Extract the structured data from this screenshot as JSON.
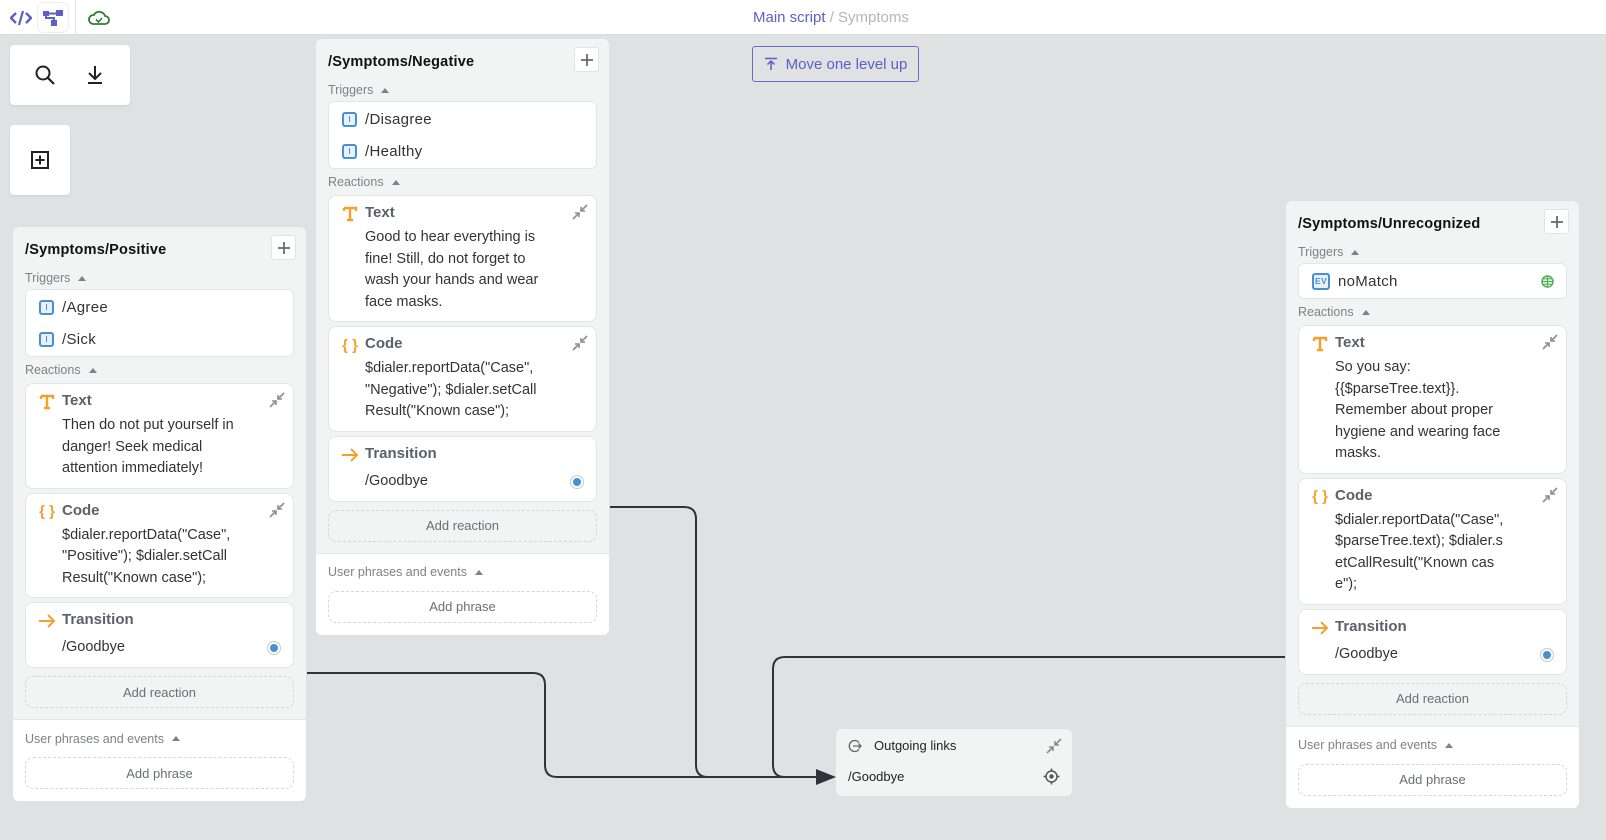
{
  "topbar": {
    "icons": [
      "code-icon",
      "flow-diagram-icon",
      "cloud-check-icon"
    ],
    "breadcrumb": {
      "parent": "Main script",
      "separator": "/",
      "current": "Symptoms"
    }
  },
  "move_up_button": {
    "label": "Move one level up"
  },
  "tools": {
    "search": "search-icon",
    "download": "download-icon",
    "add_state": "add-box-icon"
  },
  "states": [
    {
      "title": "/Symptoms/Positive",
      "triggers_label": "Triggers",
      "triggers": [
        {
          "type": "I",
          "label": "/Agree"
        },
        {
          "type": "I",
          "label": "/Sick"
        }
      ],
      "reactions_label": "Reactions",
      "reactions": {
        "text": {
          "title": "Text",
          "body": "Then do not put yourself in danger! Seek medical attention immediately!"
        },
        "code": {
          "title": "Code",
          "body": "$dialer.reportData(\"Case\", \"Positive\"); $dialer.setCallResult(\"Known case\");"
        },
        "transition": {
          "title": "Transition",
          "target": "/Goodbye"
        }
      },
      "add_reaction": "Add reaction",
      "phrases_label": "User phrases and events",
      "add_phrase": "Add phrase"
    },
    {
      "title": "/Symptoms/Negative",
      "triggers_label": "Triggers",
      "triggers": [
        {
          "type": "I",
          "label": "/Disagree"
        },
        {
          "type": "I",
          "label": "/Healthy"
        }
      ],
      "reactions_label": "Reactions",
      "reactions": {
        "text": {
          "title": "Text",
          "body": "Good to hear everything is fine! Still, do not forget to wash your hands and wear face masks."
        },
        "code": {
          "title": "Code",
          "body": "$dialer.reportData(\"Case\", \"Negative\"); $dialer.setCallResult(\"Known case\");"
        },
        "transition": {
          "title": "Transition",
          "target": "/Goodbye"
        }
      },
      "add_reaction": "Add reaction",
      "phrases_label": "User phrases and events",
      "add_phrase": "Add phrase"
    },
    {
      "title": "/Symptoms/Unrecognized",
      "triggers_label": "Triggers",
      "triggers": [
        {
          "type": "EV",
          "label": "noMatch"
        }
      ],
      "reactions_label": "Reactions",
      "reactions": {
        "text": {
          "title": "Text",
          "body": "So you say: {{$parseTree.text}}. Remember about proper hygiene and wearing face masks."
        },
        "code": {
          "title": "Code",
          "body": "$dialer.reportData(\"Case\", $parseTree.text); $dialer.setCallResult(\"Known case\");"
        },
        "transition": {
          "title": "Transition",
          "target": "/Goodbye"
        }
      },
      "add_reaction": "Add reaction",
      "phrases_label": "User phrases and events",
      "add_phrase": "Add phrase"
    }
  ],
  "outgoing_links": {
    "title": "Outgoing links",
    "items": [
      "/Goodbye"
    ]
  },
  "colors": {
    "accent": "#5b5fc7",
    "reaction_icon": "#f5a02a",
    "trigger_badge": "#4a8fd0",
    "global_icon": "#4caf50",
    "link_line": "#2f343b"
  }
}
